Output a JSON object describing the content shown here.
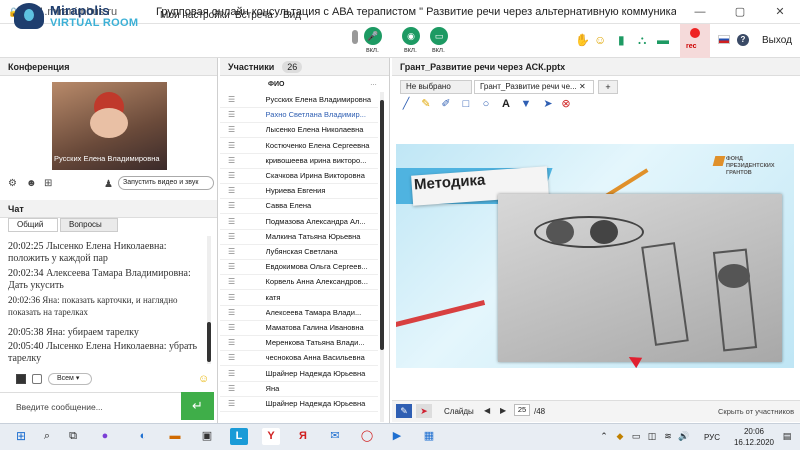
{
  "browser": {
    "url": "mf1.miranimbus.ru",
    "title": "Групповая онлайн консультация с АВА терапистом \" Развитие речи через альтернативную коммуникацию\"."
  },
  "header": {
    "logo_line1": "Mirapolis",
    "logo_line2": "VIRTUAL ROOM",
    "menu": [
      "Мои настройки",
      "Встреча",
      "Вид"
    ],
    "mic_label": "вкл.",
    "cam_label": "вкл.",
    "screen_label": "вкл.",
    "rec_label": "rec",
    "exit_label": "Выход"
  },
  "conference": {
    "title": "Конференция",
    "video_name": "Русских Елена Владимировна",
    "start_video_select": "Запустить видео и звук"
  },
  "chat": {
    "title": "Чат",
    "tabs": [
      "Общий",
      "Вопросы"
    ],
    "messages": [
      {
        "time": "20:02:25",
        "text": "Лысенко Елена Николаевна: положить у каждой пар"
      },
      {
        "time": "20:02:34",
        "text": "Алексеева Тамара Владимировна: Дать укусить"
      },
      {
        "time": "20:02:36",
        "text": "Яна: показать карточки, и наглядно показать на тарелках"
      },
      {
        "time": "20:05:38",
        "text": "Яна: убираем тарелку"
      },
      {
        "time": "20:05:40",
        "text": "Лысенко Елена Николаевна: убрать тарелку"
      }
    ],
    "recipient": "Всем",
    "input_placeholder": "Введите сообщение..."
  },
  "participants": {
    "title": "Участники",
    "count": "26",
    "column": "ФИО",
    "list": [
      "Русских Елена Владимировна",
      "Рахно Светлана Владимир...",
      "Лысенко Елена Николаевна",
      "Костюченко Елена Сергеевна",
      "кривошеева ирина викторо...",
      "Скачкова Ирина Викторовна",
      "Нуриева Евгения",
      "Савва Елена",
      "Подмазова Александра Ал...",
      "Малкина Татьяна Юрьевна",
      "Лубянская Светлана",
      "Евдокимова Ольга Сергеев...",
      "Корвель Анна Александров...",
      "катя",
      "Алексеева Тамара Влади...",
      "Маматова Галина Ивановна",
      "Меренкова Татьяна Влади...",
      "чеснокова Анна Васильевна",
      "Шрайнер Надежда Юрьевна",
      "Яна",
      "Шрайнер Надежда Юрьевна"
    ]
  },
  "presentation": {
    "title": "Грант_Развитие речи через АСК.pptx",
    "tabs": [
      "Не выбрано",
      "Грант_Развитие речи че..."
    ],
    "add_tab": "+",
    "slide_title": "Методика",
    "fund_text": "ФОНД ПРЕЗИДЕНТСКИХ ГРАНТОВ",
    "slides_label": "Слайды",
    "page": "25",
    "total": "/48",
    "hide_label": "Скрыть от участников"
  },
  "taskbar": {
    "lang": "РУС",
    "time": "20:06",
    "date": "16.12.2020"
  },
  "colors": {
    "brand_dark": "#1f3e6e",
    "brand_light": "#3cb0d6",
    "green": "#1d9a63",
    "active_blue": "#2f5fb3"
  }
}
